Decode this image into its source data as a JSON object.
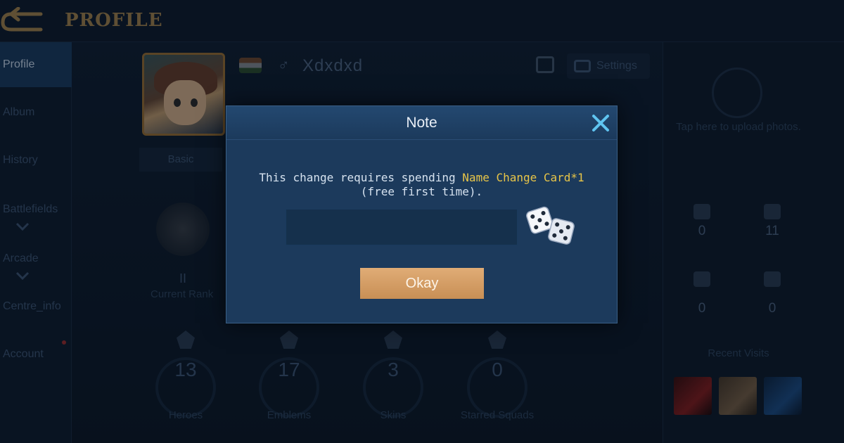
{
  "header": {
    "title": "PROFILE",
    "back_icon": "back-arrow-icon"
  },
  "sidebar": {
    "items": [
      {
        "label": "Profile",
        "active": true
      },
      {
        "label": "Album"
      },
      {
        "label": "History"
      },
      {
        "label": "Battlefields"
      },
      {
        "label": "Arcade"
      },
      {
        "label": "Centre_info"
      },
      {
        "label": "Account"
      }
    ]
  },
  "profile": {
    "name": "Xdxdxd",
    "gender_symbol": "♂",
    "settings_label": "Settings",
    "basic_tab": "Basic",
    "rank_numeral": "II",
    "rank_label": "Current Rank",
    "stats": [
      {
        "value": "13",
        "label": "Heroes"
      },
      {
        "value": "17",
        "label": "Emblems"
      },
      {
        "value": "3",
        "label": "Skins"
      },
      {
        "value": "0",
        "label": "Starred Squads"
      }
    ]
  },
  "right_panel": {
    "upload_text": "Tap here to upload photos.",
    "counters": [
      {
        "icon": "fire-icon",
        "value": "0"
      },
      {
        "icon": "followers-icon",
        "value": "11"
      },
      {
        "icon": "gift-icon",
        "value": "0"
      },
      {
        "icon": "thumbs-up-icon",
        "value": "0"
      }
    ],
    "visits_label": "Recent Visits"
  },
  "dialog": {
    "title": "Note",
    "message_before": "This change requires spending ",
    "message_highlight": "Name Change Card*1",
    "message_after": " (free first time).",
    "input_value": "",
    "input_placeholder": "",
    "okay_label": "Okay"
  },
  "colors": {
    "highlight": "#e8c548",
    "okay_button": "#d9a26b",
    "dialog_bg": "#1c3a5c",
    "title_gold": "#a9884f"
  }
}
